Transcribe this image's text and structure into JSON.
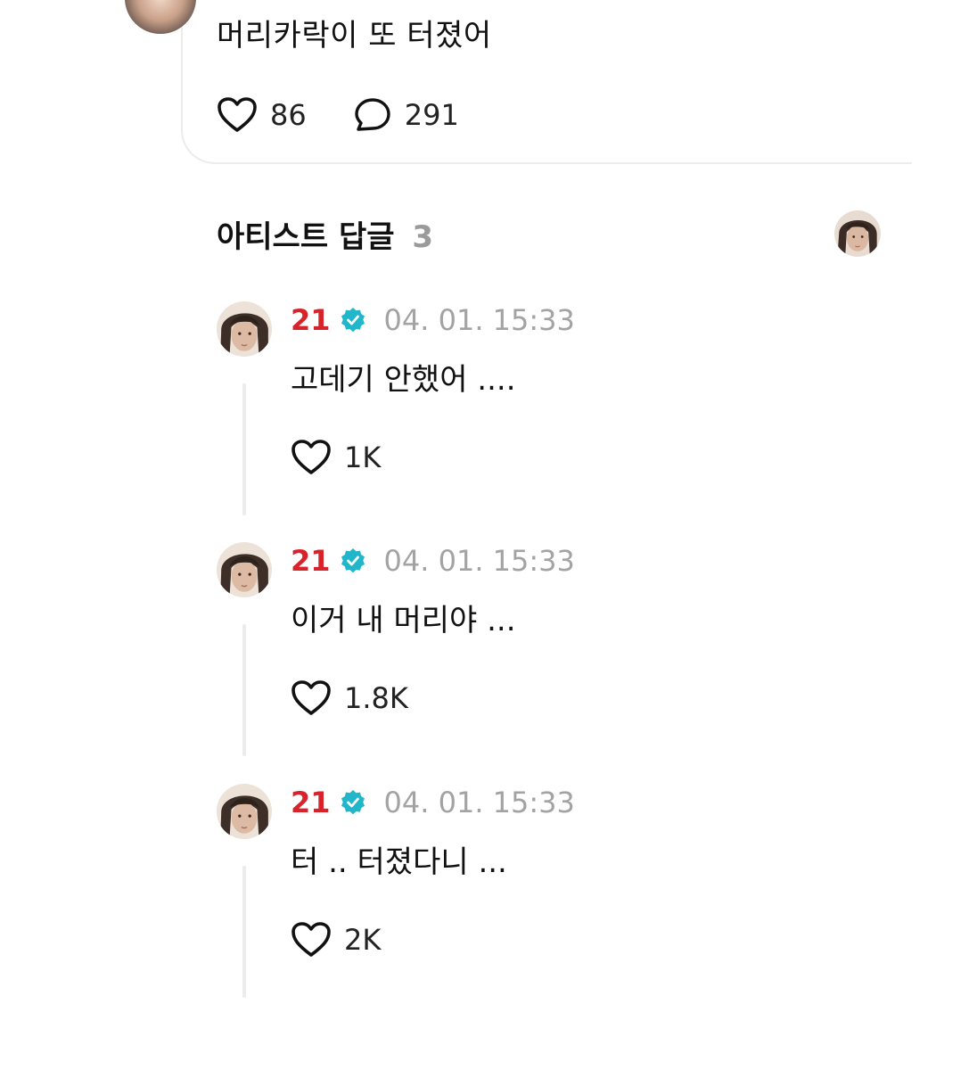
{
  "post": {
    "text": "머리카락이 또 터졌어",
    "likes": "86",
    "comments": "291"
  },
  "section": {
    "title": "아티스트 답글",
    "count": "3"
  },
  "replies": [
    {
      "author": "21",
      "time": "04. 01. 15:33",
      "text": "고데기 안했어 ....",
      "likes": "1K"
    },
    {
      "author": "21",
      "time": "04. 01. 15:33",
      "text": "이거 내 머리야 ...",
      "likes": "1.8K"
    },
    {
      "author": "21",
      "time": "04. 01. 15:33",
      "text": "터 .. 터졌다니 ...",
      "likes": "2K"
    }
  ],
  "colors": {
    "author": "#d8232a",
    "verified": "#21b6c9",
    "timestamp": "#a3a3a3",
    "count_muted": "#9a9a9a",
    "divider": "#ececee"
  },
  "icons": {
    "like": "heart-outline-icon",
    "comment": "speech-bubble-icon",
    "verified": "verified-badge-icon"
  }
}
